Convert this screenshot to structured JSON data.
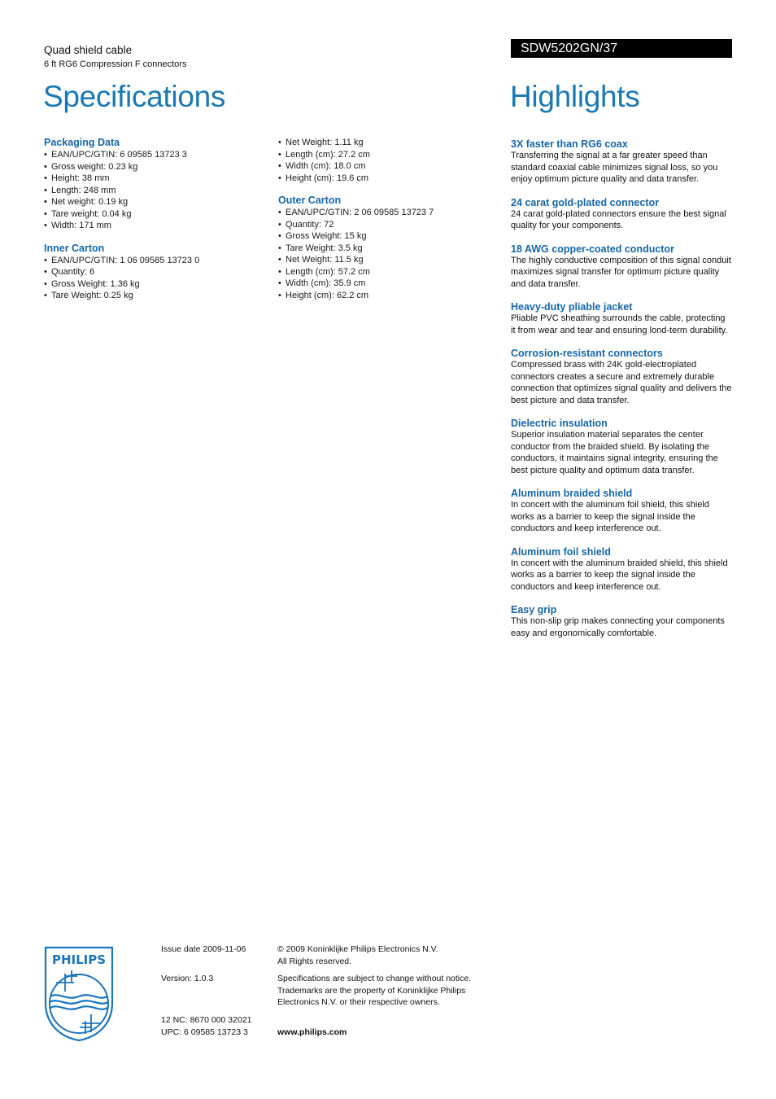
{
  "header": {
    "product_name": "Quad shield cable",
    "product_subtitle": "6 ft RG6 Compression F connectors",
    "model": "SDW5202GN/37",
    "specifications_title": "Specifications",
    "highlights_title": "Highlights"
  },
  "colors": {
    "accent_blue": "#1a78b3",
    "heading_blue": "#1766a8",
    "model_bar_bg": "#000000"
  },
  "specifications": {
    "column1": [
      {
        "heading": "Packaging Data",
        "items": [
          "EAN/UPC/GTIN: 6 09585 13723 3",
          "Gross weight: 0.23 kg",
          "Height: 38 mm",
          "Length: 248 mm",
          "Net weight: 0.19 kg",
          "Tare weight: 0.04 kg",
          "Width: 171 mm"
        ]
      },
      {
        "heading": "Inner Carton",
        "items": [
          "EAN/UPC/GTIN: 1 06 09585 13723 0",
          "Quantity: 6",
          "Gross Weight: 1.36 kg",
          "Tare Weight: 0.25 kg"
        ]
      }
    ],
    "column2_continued": [
      "Net Weight: 1.11 kg",
      "Length (cm): 27.2 cm",
      "Width (cm): 18.0 cm",
      "Height (cm): 19.6 cm"
    ],
    "column2": [
      {
        "heading": "Outer Carton",
        "items": [
          "EAN/UPC/GTIN: 2 06 09585 13723 7",
          "Quantity: 72",
          "Gross Weight: 15 kg",
          "Tare Weight: 3.5 kg",
          "Net Weight: 11.5 kg",
          "Length (cm): 57.2 cm",
          "Width (cm): 35.9 cm",
          "Height (cm): 62.2 cm"
        ]
      }
    ]
  },
  "highlights": [
    {
      "title": "3X faster than RG6 coax",
      "text": "Transferring the signal at a far greater speed than standard coaxial cable minimizes signal loss, so you enjoy optimum picture quality and data transfer."
    },
    {
      "title": "24 carat gold-plated connector",
      "text": "24 carat gold-plated connectors ensure the best signal quality for your components."
    },
    {
      "title": "18 AWG copper-coated conductor",
      "text": "The highly conductive composition of this signal conduit maximizes signal transfer for optimum picture quality and data transfer."
    },
    {
      "title": "Heavy-duty pliable jacket",
      "text": "Pliable PVC sheathing surrounds the cable, protecting it from wear and tear and ensuring lond-term durability."
    },
    {
      "title": "Corrosion-resistant connectors",
      "text": "Compressed brass with 24K gold-electroplated connectors creates a secure and extremely durable connection that optimizes signal quality and delivers the best picture and data transfer."
    },
    {
      "title": "Dielectric insulation",
      "text": "Superior insulation material separates the center conductor from the braided shield. By isolating the conductors, it maintains signal integrity, ensuring the best picture quality and optimum data transfer."
    },
    {
      "title": "Aluminum braided shield",
      "text": "In concert with the aluminum foil shield, this shield works as a barrier to keep the signal inside the conductors and keep interference out."
    },
    {
      "title": "Aluminum foil shield",
      "text": "In concert with the aluminum braided shield, this shield works as a barrier to keep the signal inside the conductors and keep interference out."
    },
    {
      "title": "Easy grip",
      "text": "This non-slip grip makes connecting your components easy and ergonomically comfortable."
    }
  ],
  "footer": {
    "logo_text": "PHILIPS",
    "logo_icon": "philips-shield-icon",
    "issue_date": "Issue date 2009-11-06",
    "version": "Version: 1.0.3",
    "nc": "12 NC: 8670 000 32021",
    "upc": "UPC: 6 09585 13723 3",
    "copyright_line1": "© 2009 Koninklijke Philips Electronics N.V.",
    "copyright_line2": "All Rights reserved.",
    "notice_line1": "Specifications are subject to change without notice.",
    "notice_line2": "Trademarks are the property of Koninklijke Philips",
    "notice_line3": "Electronics N.V. or their respective owners.",
    "website": "www.philips.com"
  }
}
